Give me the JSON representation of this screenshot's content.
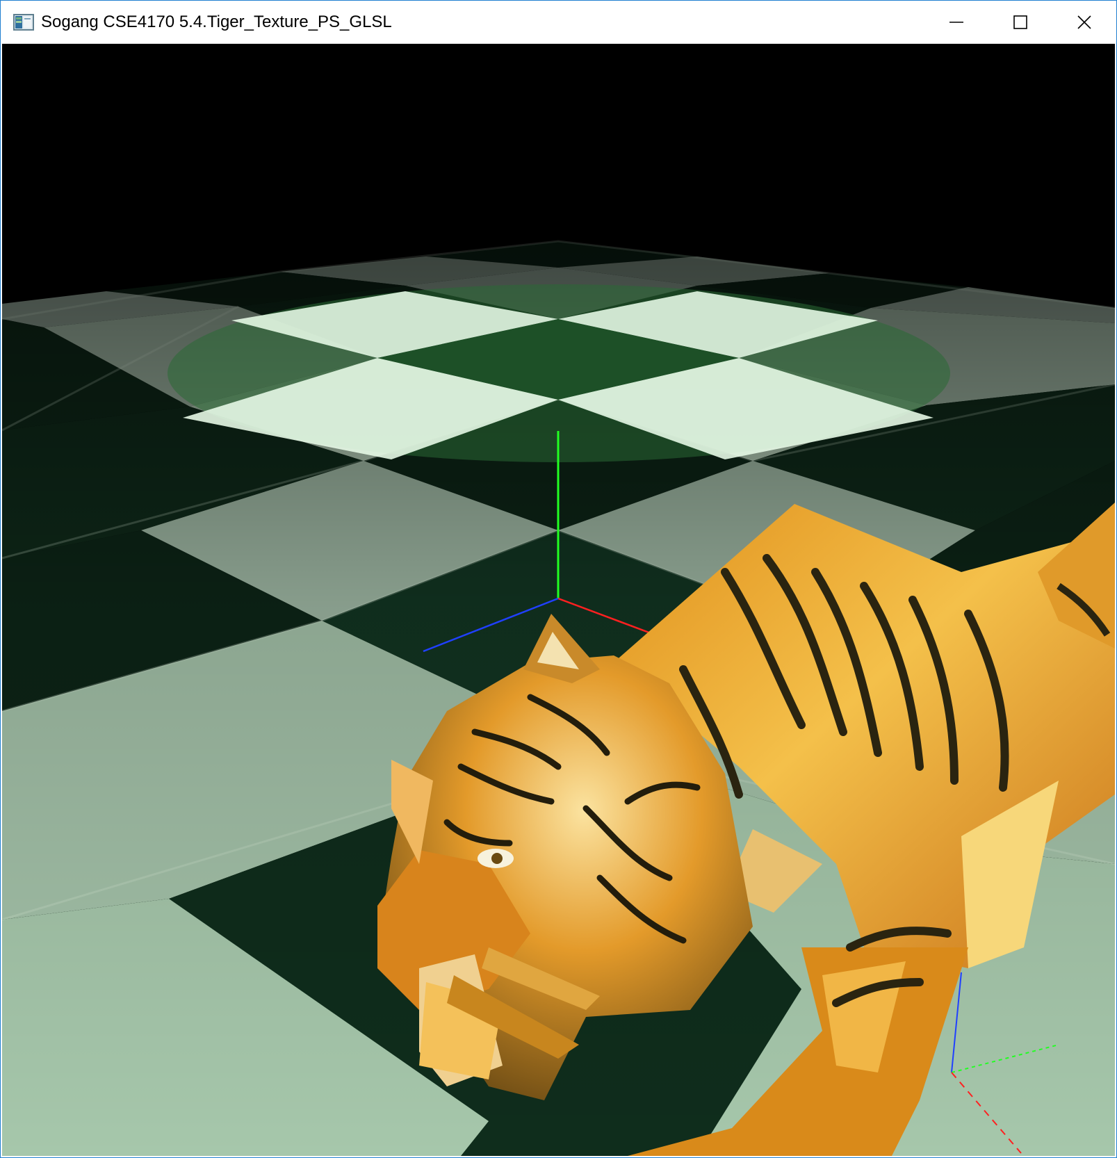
{
  "window": {
    "title": "Sogang CSE4170 5.4.Tiger_Texture_PS_GLSL",
    "app_icon": "opengl-app-icon",
    "controls": {
      "minimize_icon": "minimize-icon",
      "maximize_icon": "maximize-icon",
      "close_icon": "close-icon"
    },
    "border_color": "#1f7fd1"
  },
  "scene": {
    "background_color": "#000000",
    "floor_light_color": "#a9c9ad",
    "floor_dark_color": "#0c2216",
    "spotlight_color": "#2a6a34",
    "tiger_colors": [
      "#d98a1a",
      "#f2b23a",
      "#2a2410",
      "#fff2c0"
    ],
    "axis_colors": {
      "x": "#ff2020",
      "y": "#20ff20",
      "z": "#2040ff"
    }
  }
}
